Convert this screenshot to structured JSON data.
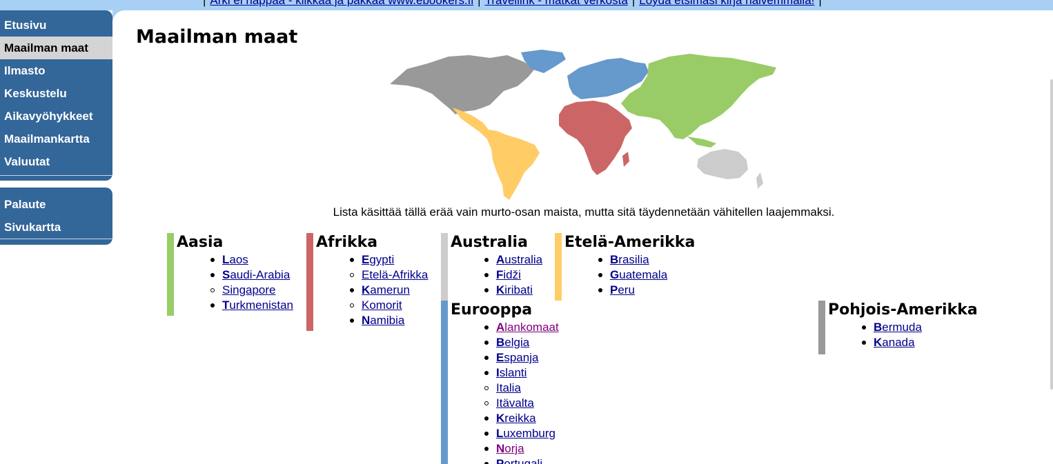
{
  "topbar": {
    "links": [
      "Arki ei nappaa - klikkaa ja pakkaa www.ebookers.fi",
      "Travellink - matkat verkosta",
      "Löydä etsimäsi kirja halvemmalla!"
    ],
    "separator": "|"
  },
  "sidebar": {
    "main_items": [
      {
        "label": "Etusivu"
      },
      {
        "label": "Maailman maat",
        "active": true
      },
      {
        "label": "Ilmasto"
      },
      {
        "label": "Keskustelu"
      },
      {
        "label": "Aikavyöhykkeet"
      },
      {
        "label": "Maailmankartta"
      },
      {
        "label": "Valuutat"
      }
    ],
    "secondary_items": [
      {
        "label": "Palaute"
      },
      {
        "label": "Sivukartta"
      }
    ]
  },
  "page": {
    "title": "Maailman maat",
    "note": "Lista käsittää tällä erää vain murto-osan maista, mutta sitä täydennetään vähitellen laajemmaksi."
  },
  "colors": {
    "menu_bg": "#336699",
    "menu_active": "#d4d4d4",
    "topbar_bg": "#a8d0f5",
    "asia": "#99cc66",
    "africa": "#cc6666",
    "australia": "#cccccc",
    "south_america": "#ffcc66",
    "europe": "#6699cc",
    "north_america": "#999999",
    "link": "#00008b",
    "visited": "#800080"
  },
  "regions": {
    "asia": {
      "name": "Aasia",
      "countries": [
        {
          "initial": "L",
          "rest": "aos"
        },
        {
          "initial": "S",
          "rest": "audi-Arabia"
        },
        {
          "initial": "",
          "rest": "Singapore"
        },
        {
          "initial": "T",
          "rest": "urkmenistan"
        }
      ]
    },
    "africa": {
      "name": "Afrikka",
      "countries": [
        {
          "initial": "E",
          "rest": "gypti"
        },
        {
          "initial": "",
          "rest": "Etelä-Afrikka"
        },
        {
          "initial": "K",
          "rest": "amerun"
        },
        {
          "initial": "",
          "rest": "Komorit"
        },
        {
          "initial": "N",
          "rest": "amibia"
        }
      ]
    },
    "australia": {
      "name": "Australia",
      "countries": [
        {
          "initial": "A",
          "rest": "ustralia"
        },
        {
          "initial": "F",
          "rest": "idži"
        },
        {
          "initial": "K",
          "rest": "iribati"
        }
      ]
    },
    "south_america": {
      "name": "Etelä-Amerikka",
      "countries": [
        {
          "initial": "B",
          "rest": "rasilia"
        },
        {
          "initial": "G",
          "rest": "uatemala"
        },
        {
          "initial": "P",
          "rest": "eru"
        }
      ]
    },
    "europe": {
      "name": "Eurooppa",
      "countries": [
        {
          "initial": "A",
          "rest": "lankomaat"
        },
        {
          "initial": "B",
          "rest": "elgia"
        },
        {
          "initial": "E",
          "rest": "spanja"
        },
        {
          "initial": "I",
          "rest": "slanti"
        },
        {
          "initial": "",
          "rest": "Italia"
        },
        {
          "initial": "",
          "rest": "Itävalta"
        },
        {
          "initial": "K",
          "rest": "reikka"
        },
        {
          "initial": "L",
          "rest": "uxemburg"
        },
        {
          "initial": "N",
          "rest": "orja"
        },
        {
          "initial": "P",
          "rest": "ortugali"
        }
      ]
    },
    "north_america": {
      "name": "Pohjois-Amerikka",
      "countries": [
        {
          "initial": "B",
          "rest": "ermuda"
        },
        {
          "initial": "K",
          "rest": "anada"
        }
      ]
    }
  }
}
